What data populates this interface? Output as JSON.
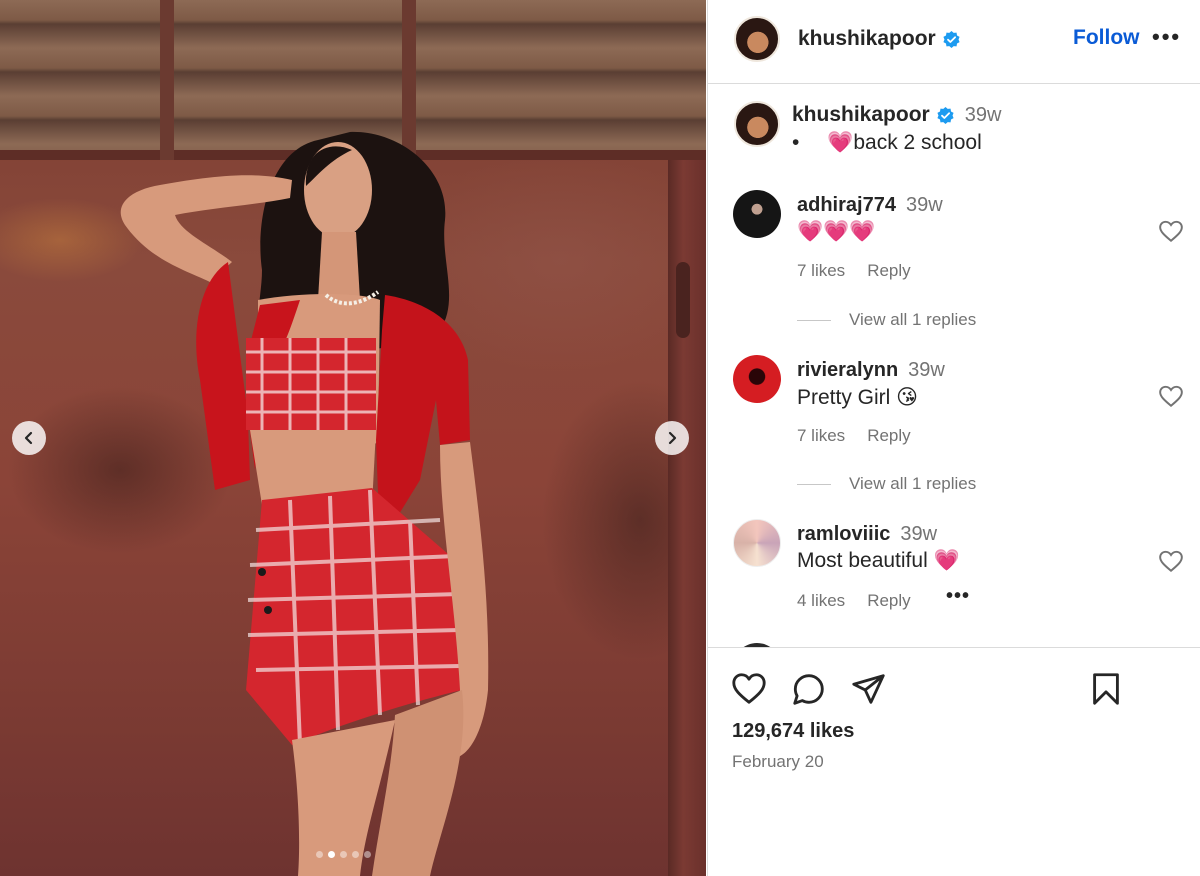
{
  "post": {
    "username": "khushikapoor",
    "follow_label": "Follow",
    "more_label": "•••",
    "carousel": {
      "slide_count": 5,
      "active_slide": 2
    }
  },
  "caption": {
    "username": "khushikapoor",
    "time": "39w",
    "bullet": "•",
    "text": "💗back 2 school"
  },
  "comments": [
    {
      "username": "adhiraj774",
      "time": "39w",
      "text": "💗💗💗",
      "likes": "7 likes",
      "reply_label": "Reply",
      "view_replies": "View all 1 replies"
    },
    {
      "username": "rivieralynn",
      "time": "39w",
      "text": "Pretty Girl 😘",
      "likes": "7 likes",
      "reply_label": "Reply",
      "view_replies": "View all 1 replies"
    },
    {
      "username": "ramloviiic",
      "time": "39w",
      "text": "Most beautiful 💗",
      "likes": "4 likes",
      "reply_label": "Reply",
      "more_label": "•••"
    }
  ],
  "footer": {
    "likes": "129,674 likes",
    "date": "February 20"
  },
  "icons": {
    "like": "heart-outline-icon",
    "comment": "speech-bubble-icon",
    "share": "paper-plane-icon",
    "save": "bookmark-icon",
    "verified": "verified-badge-icon"
  },
  "colors": {
    "link_blue": "#0a5bd6",
    "verified_blue": "#1d9bf0",
    "secondary_text": "#737373",
    "divider": "#dbdbdb"
  }
}
